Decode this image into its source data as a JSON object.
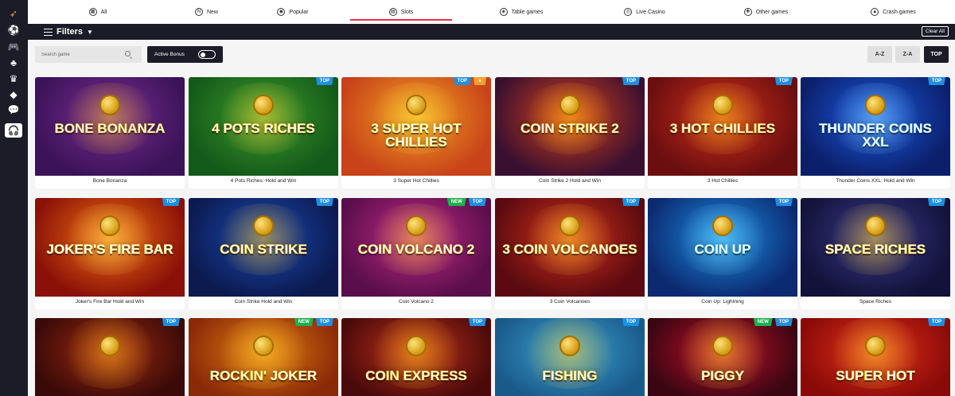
{
  "sidebar": {
    "items": [
      {
        "icon": "rocket-icon"
      },
      {
        "icon": "soccer-ball-icon"
      },
      {
        "icon": "gamepad-icon"
      },
      {
        "icon": "clover-icon"
      },
      {
        "icon": "crown-icon"
      },
      {
        "icon": "diamond-icon"
      },
      {
        "icon": "chat-icon"
      },
      {
        "icon": "headset-icon"
      }
    ]
  },
  "tabs": [
    {
      "label": "All",
      "icon": "all-icon",
      "glyph": "▦"
    },
    {
      "label": "New",
      "icon": "new-icon",
      "glyph": "N"
    },
    {
      "label": "Popular",
      "icon": "popular-icon",
      "glyph": "◉"
    },
    {
      "label": "Slots",
      "icon": "slots-icon",
      "glyph": "▤",
      "active": true
    },
    {
      "label": "Table games",
      "icon": "table-games-icon",
      "glyph": "◈"
    },
    {
      "label": "Live Casino",
      "icon": "live-casino-icon",
      "glyph": "◎"
    },
    {
      "label": "Other games",
      "icon": "other-games-icon",
      "glyph": "✚"
    },
    {
      "label": "Crash games",
      "icon": "crash-games-icon",
      "glyph": "▲"
    }
  ],
  "filters": {
    "label": "Filters",
    "clear_label": "Clear All"
  },
  "search": {
    "placeholder": "Search game"
  },
  "active_bonus": {
    "label": "Active Bonus",
    "enabled": false
  },
  "sort": {
    "options": [
      "A-Z",
      "Z-A",
      "TOP"
    ],
    "selected": "TOP"
  },
  "games": [
    {
      "title": "Bone Bonanza",
      "art": "BONE BONANZA",
      "badges": [],
      "bg": [
        "#7a2d8f",
        "#3b1359"
      ],
      "accent": "#f5b82a"
    },
    {
      "title": "4 Pots Riches: Hold and Win",
      "art": "4 POTS RICHES",
      "badges": [
        "TOP"
      ],
      "bg": [
        "#3b9a2a",
        "#145a1a"
      ],
      "accent": "#ffd23a"
    },
    {
      "title": "3 Super Hot Chillies",
      "art": "3 SUPER HOT CHILLIES",
      "badges": [
        "TOP",
        "HOT"
      ],
      "bg": [
        "#f0a020",
        "#c8421a"
      ],
      "accent": "#ffe040"
    },
    {
      "title": "Coin Strike 2 Hold and Win",
      "art": "COIN STRIKE 2",
      "badges": [
        "TOP"
      ],
      "bg": [
        "#d8401a",
        "#3a1030"
      ],
      "accent": "#ffc21a"
    },
    {
      "title": "3 Hot Chillies",
      "art": "3 HOT CHILLIES",
      "badges": [
        "TOP"
      ],
      "bg": [
        "#d0301a",
        "#6a0e10"
      ],
      "accent": "#f8c020"
    },
    {
      "title": "Thunder Coins XXL: Hold and Win",
      "art": "THUNDER COINS XXL",
      "badges": [
        "TOP"
      ],
      "bg": [
        "#1a5ae0",
        "#0c1f6a"
      ],
      "accent": "#8ad8ff"
    },
    {
      "title": "Joker's Fire Bar Hold and Win",
      "art": "JOKER'S FIRE BAR",
      "badges": [
        "TOP"
      ],
      "bg": [
        "#f07010",
        "#8a1008"
      ],
      "accent": "#ffe060"
    },
    {
      "title": "Coin Strike Hold and Win",
      "art": "COIN STRIKE",
      "badges": [
        "TOP"
      ],
      "bg": [
        "#1a4ab0",
        "#0c1a50"
      ],
      "accent": "#ffc21a"
    },
    {
      "title": "Coin Volcano 2",
      "art": "COIN VOLCANO 2",
      "badges": [
        "NEW",
        "TOP"
      ],
      "bg": [
        "#c02a8a",
        "#5a0e4a"
      ],
      "accent": "#ffd030"
    },
    {
      "title": "3 Coin Volcanoes",
      "art": "3 COIN VOLCANOES",
      "badges": [
        "TOP"
      ],
      "bg": [
        "#d0301a",
        "#5a0a10"
      ],
      "accent": "#ffd030"
    },
    {
      "title": "Coin Up: Lightning",
      "art": "COIN UP",
      "badges": [
        "TOP"
      ],
      "bg": [
        "#1a8ae0",
        "#0c2a70"
      ],
      "accent": "#7ae0ff"
    },
    {
      "title": "Space Riches",
      "art": "SPACE RICHES",
      "badges": [
        "TOP"
      ],
      "bg": [
        "#3a3a8a",
        "#12123a"
      ],
      "accent": "#ffd030"
    },
    {
      "title": "",
      "art": "",
      "badges": [
        "TOP"
      ],
      "bg": [
        "#a02a10",
        "#3a0a08"
      ],
      "accent": "#ffb020"
    },
    {
      "title": "",
      "art": "ROCKIN' JOKER",
      "badges": [
        "NEW",
        "TOP"
      ],
      "bg": [
        "#e07a10",
        "#8a2a08"
      ],
      "accent": "#ffd030"
    },
    {
      "title": "",
      "art": "COIN EXPRESS",
      "badges": [
        "TOP"
      ],
      "bg": [
        "#c0301a",
        "#4a0a0a"
      ],
      "accent": "#ffc21a"
    },
    {
      "title": "",
      "art": "FISHING",
      "badges": [
        "TOP"
      ],
      "bg": [
        "#3aa0d0",
        "#1a5a8a"
      ],
      "accent": "#ffd030"
    },
    {
      "title": "",
      "art": "PIGGY",
      "badges": [
        "NEW",
        "TOP"
      ],
      "bg": [
        "#c0102a",
        "#3a0612"
      ],
      "accent": "#ffd030"
    },
    {
      "title": "",
      "art": "SUPER HOT",
      "badges": [
        "TOP"
      ],
      "bg": [
        "#e0301a",
        "#8a0a08"
      ],
      "accent": "#ffd030"
    }
  ]
}
